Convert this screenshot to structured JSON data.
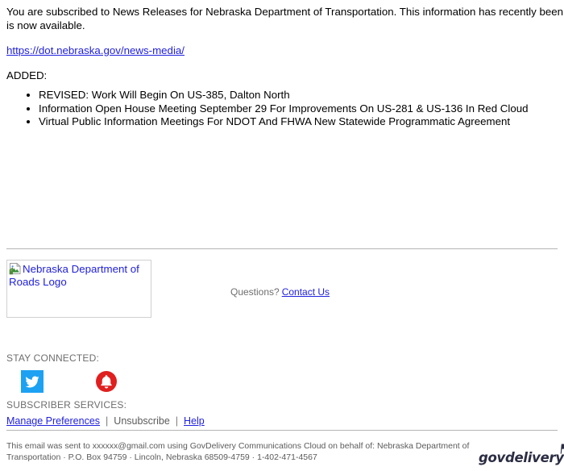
{
  "message": {
    "intro_line_1": "You are subscribed to News Releases for Nebraska Department of Transportation. This information has recently been updated, and",
    "intro_line_2": "is now available.",
    "url": "https://dot.nebraska.gov/news-media/",
    "added_label": "ADDED:",
    "items": [
      "REVISED: Work Will Begin On US-385, Dalton North",
      "Information Open House Meeting September 29 For Improvements On US-281 & US-136 In Red Cloud",
      "Virtual Public Information Meetings For NDOT And FHWA New Statewide Programmatic Agreement"
    ]
  },
  "logo": {
    "alt_text": "Nebraska Department of Roads Logo",
    "icon": "broken-image-icon"
  },
  "contact": {
    "question_text": "Questions?",
    "link_label": "Contact Us"
  },
  "stay_connected": {
    "label": "STAY CONNECTED:",
    "social": [
      {
        "name": "twitter-icon",
        "label": "Twitter"
      },
      {
        "name": "subscribe-bell-icon",
        "label": "Subscribe"
      }
    ]
  },
  "subscriber_services": {
    "label": "SUBSCRIBER SERVICES:",
    "manage_label": "Manage Preferences",
    "unsubscribe_label": "Unsubscribe",
    "help_label": "Help",
    "separator": "|"
  },
  "footer": {
    "line_1": "This email was sent to xxxxxx@gmail.com using GovDelivery Communications Cloud on behalf of: Nebraska Department of",
    "line_2": "Transportation · P.O. Box 94759 · Lincoln, Nebraska 68509-4759 · 1-402-471-4567",
    "brand": "govdelivery"
  },
  "colors": {
    "link": "#2121de",
    "muted_text": "#5b5b5b",
    "label_gray": "#6e6e6e",
    "divider": "#b5b5b5",
    "twitter_blue": "#1da1f2",
    "bell_red": "#e01f1f",
    "brand_dark": "#2b2d42"
  }
}
